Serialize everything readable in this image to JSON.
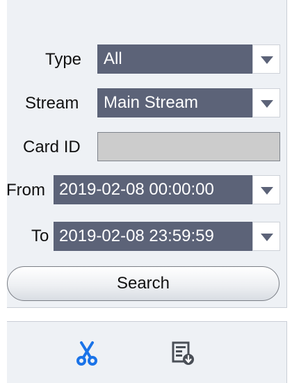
{
  "form": {
    "type": {
      "label": "Type",
      "value": "All"
    },
    "stream": {
      "label": "Stream",
      "value": "Main Stream"
    },
    "card_id": {
      "label": "Card ID",
      "value": ""
    },
    "from": {
      "label": "From",
      "value": "2019-02-08 00:00:00"
    },
    "to": {
      "label": "To",
      "value": "2019-02-08 23:59:59"
    },
    "search_label": "Search"
  },
  "toolbar": {
    "icons": [
      "scissors-icon",
      "export-icon"
    ],
    "colors": {
      "scissors": "#1a73e8",
      "export": "#4a4f57"
    }
  },
  "colors": {
    "select_bg": "#5c6378",
    "panel_bg": "#eef1f5",
    "field_disabled": "#cccccc"
  }
}
